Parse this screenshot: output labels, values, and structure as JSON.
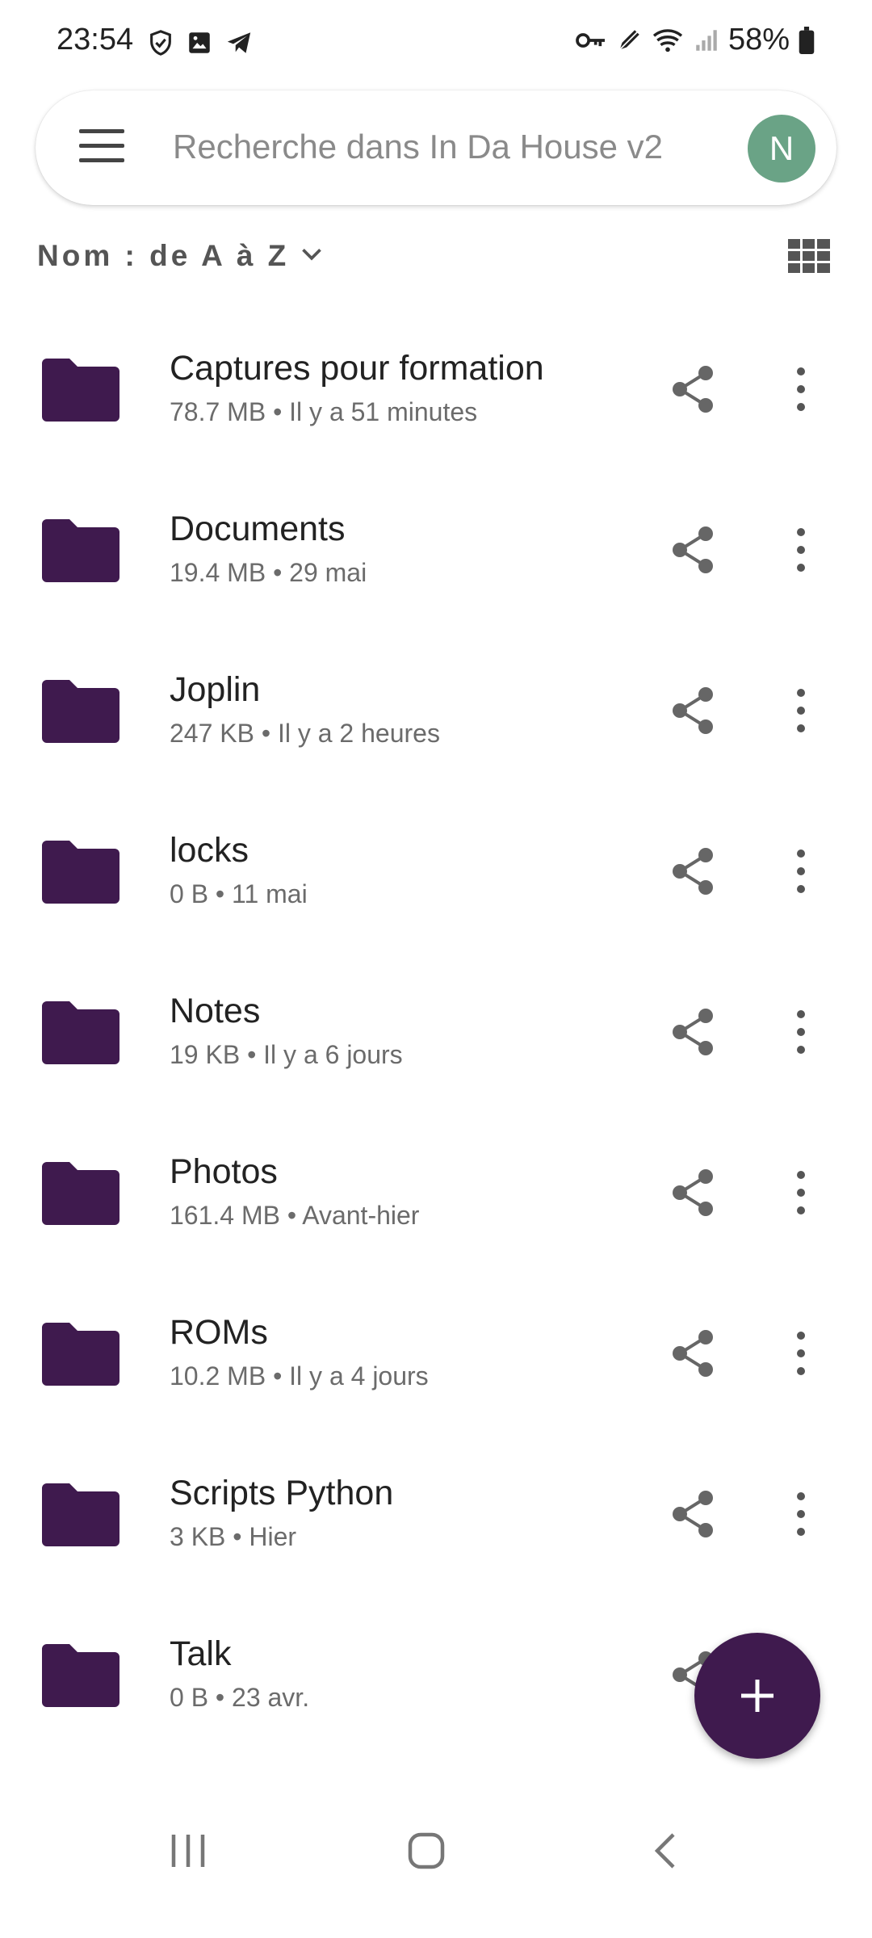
{
  "status_bar": {
    "time": "23:54",
    "battery": "58%",
    "left_icons": [
      "shield-icon",
      "image-icon",
      "telegram-icon"
    ],
    "right_icons": [
      "vpn-key-icon",
      "edit-icon",
      "wifi-icon",
      "signal-icon",
      "battery-icon"
    ]
  },
  "search": {
    "placeholder": "Recherche dans In Da House v2",
    "avatar_letter": "N",
    "avatar_color": "#6aa386"
  },
  "sort": {
    "label": "Nom : de A à Z"
  },
  "colors": {
    "folder": "#3f1a4e",
    "fab": "#3f1a4e"
  },
  "folders": [
    {
      "name": "Captures pour formation",
      "meta": "78.7 MB • Il y a 51 minutes"
    },
    {
      "name": "Documents",
      "meta": "19.4 MB • 29 mai"
    },
    {
      "name": "Joplin",
      "meta": "247 KB • Il y a 2 heures"
    },
    {
      "name": "locks",
      "meta": "0 B • 11 mai"
    },
    {
      "name": "Notes",
      "meta": "19 KB • Il y a 6 jours"
    },
    {
      "name": "Photos",
      "meta": "161.4 MB • Avant-hier"
    },
    {
      "name": "ROMs",
      "meta": "10.2 MB • Il y a 4 jours"
    },
    {
      "name": "Scripts Python",
      "meta": "3 KB • Hier"
    },
    {
      "name": "Talk",
      "meta": "0 B • 23 avr."
    }
  ]
}
